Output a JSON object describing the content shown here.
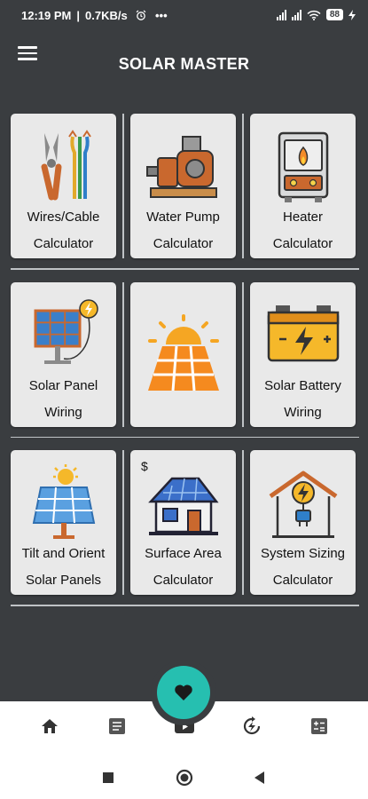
{
  "status_bar": {
    "time": "12:19 PM",
    "network_speed": "0.7KB/s",
    "alarm_icon": "alarm-icon",
    "more": "•••",
    "battery_level": "88"
  },
  "app_bar": {
    "title": "SOLAR MASTER",
    "menu_icon": "hamburger-menu-icon"
  },
  "grid": {
    "cards": [
      {
        "line1": "Wires/Cable",
        "line2": "Calculator",
        "icon": "pliers-wires-icon"
      },
      {
        "line1": "Water Pump",
        "line2": "Calculator",
        "icon": "water-pump-icon"
      },
      {
        "line1": "Heater",
        "line2": "Calculator",
        "icon": "water-heater-icon"
      },
      {
        "line1": "Solar Panel",
        "line2": "Wiring",
        "icon": "solar-panel-wiring-icon"
      },
      {
        "line1": "",
        "line2": "",
        "icon": "sun-solar-panel-icon"
      },
      {
        "line1": "Solar Battery",
        "line2": "Wiring",
        "icon": "battery-icon"
      },
      {
        "line1": "Tilt and Orient",
        "line2": "Solar Panels",
        "icon": "tilted-solar-panel-icon"
      },
      {
        "line1": "Surface Area",
        "line2": "Calculator",
        "icon": "house-solar-roof-icon",
        "badge": "$"
      },
      {
        "line1": "System Sizing",
        "line2": "Calculator",
        "icon": "home-energy-icon"
      }
    ]
  },
  "bottom_nav": {
    "items": [
      "home-icon",
      "article-icon",
      "youtube-icon",
      "refresh-energy-icon",
      "calculator-icon"
    ],
    "fab_icon": "heart-icon"
  },
  "colors": {
    "background": "#3a3d40",
    "card": "#e9e9e9",
    "fab": "#26bfb0"
  }
}
